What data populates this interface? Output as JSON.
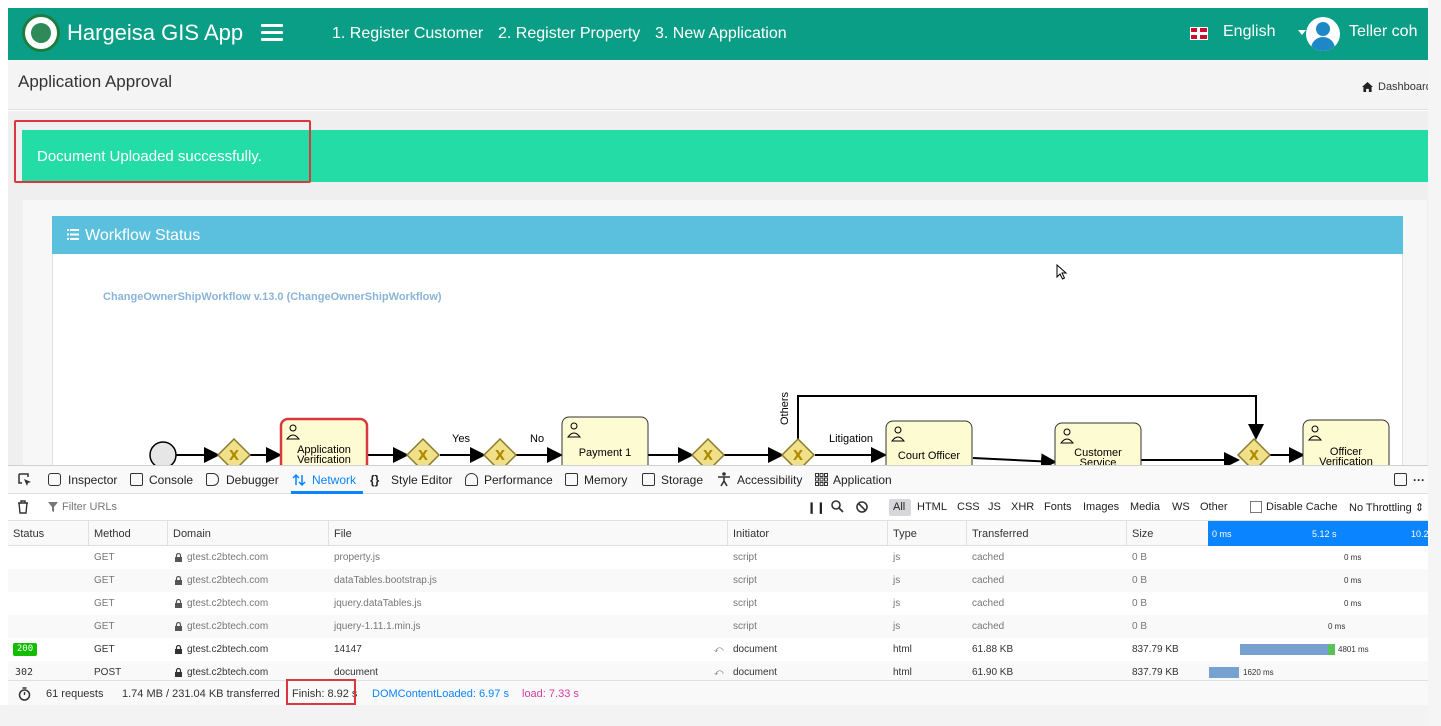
{
  "navbar": {
    "brand": "Hargeisa GIS App",
    "links": [
      "1. Register Customer",
      "2. Register Property",
      "3. New Application"
    ],
    "language": "English",
    "user": "Teller coh"
  },
  "page": {
    "title": "Application Approval",
    "breadcrumb": "Dashboard"
  },
  "alert": {
    "message": "Document Uploaded successfully."
  },
  "workflow": {
    "card_title": "Workflow Status",
    "name": "ChangeOwnerShipWorkflow v.13.0 (ChangeOwnerShipWorkflow)",
    "tasks": {
      "app_verification_line1": "Application",
      "app_verification_line2": "Verification",
      "payment": "Payment 1",
      "court_officer": "Court Officer",
      "customer_service_line1": "Customer",
      "customer_service_line2": "Service",
      "officer_verification_line1": "Officer",
      "officer_verification_line2": "Verification"
    },
    "labels": {
      "yes": "Yes",
      "no": "No",
      "others": "Others",
      "litigation": "Litigation"
    }
  },
  "devtools": {
    "tabs": [
      "Inspector",
      "Console",
      "Debugger",
      "Network",
      "Style Editor",
      "Performance",
      "Memory",
      "Storage",
      "Accessibility",
      "Application"
    ],
    "active_tab": "Network",
    "filter_placeholder": "Filter URLs",
    "type_filters": [
      "All",
      "HTML",
      "CSS",
      "JS",
      "XHR",
      "Fonts",
      "Images",
      "Media",
      "WS",
      "Other"
    ],
    "disable_cache": "Disable Cache",
    "throttling": "No Throttling ⇕",
    "columns": [
      "Status",
      "Method",
      "Domain",
      "File",
      "Initiator",
      "Type",
      "Transferred",
      "Size"
    ],
    "timeline_ticks": [
      "0 ms",
      "5.12 s",
      "10.2"
    ],
    "rows": [
      {
        "status": "",
        "method": "GET",
        "domain": "gtest.c2btech.com",
        "file": "property.js",
        "initiator": "script",
        "type": "js",
        "transferred": "cached",
        "size": "0 B",
        "timing": "0 ms"
      },
      {
        "status": "",
        "method": "GET",
        "domain": "gtest.c2btech.com",
        "file": "dataTables.bootstrap.js",
        "initiator": "script",
        "type": "js",
        "transferred": "cached",
        "size": "0 B",
        "timing": "0 ms"
      },
      {
        "status": "",
        "method": "GET",
        "domain": "gtest.c2btech.com",
        "file": "jquery.dataTables.js",
        "initiator": "script",
        "type": "js",
        "transferred": "cached",
        "size": "0 B",
        "timing": "0 ms"
      },
      {
        "status": "",
        "method": "GET",
        "domain": "gtest.c2btech.com",
        "file": "jquery-1.11.1.min.js",
        "initiator": "script",
        "type": "js",
        "transferred": "cached",
        "size": "0 B",
        "timing": "0 ms"
      },
      {
        "status": "200",
        "method": "GET",
        "domain": "gtest.c2btech.com",
        "file": "14147",
        "initiator": "document",
        "type": "html",
        "transferred": "61.88 KB",
        "size": "837.79 KB",
        "timing": "4801 ms"
      },
      {
        "status": "302",
        "method": "POST",
        "domain": "gtest.c2btech.com",
        "file": "document",
        "initiator": "document",
        "type": "html",
        "transferred": "61.90 KB",
        "size": "837.79 KB",
        "timing": "1620 ms"
      }
    ],
    "summary": {
      "requests": "61 requests",
      "transferred": "1.74 MB / 231.04 KB transferred",
      "finish": "Finish: 8.92 s",
      "dom_content_loaded": "DOMContentLoaded: 6.97 s",
      "load": "load: 7.33 s"
    }
  },
  "colors": {
    "navbar": "#0b9e86",
    "alert": "#24dca6",
    "card_header": "#5bc0de",
    "highlight": "#d9393e",
    "devtools_accent": "#0a84ff"
  }
}
